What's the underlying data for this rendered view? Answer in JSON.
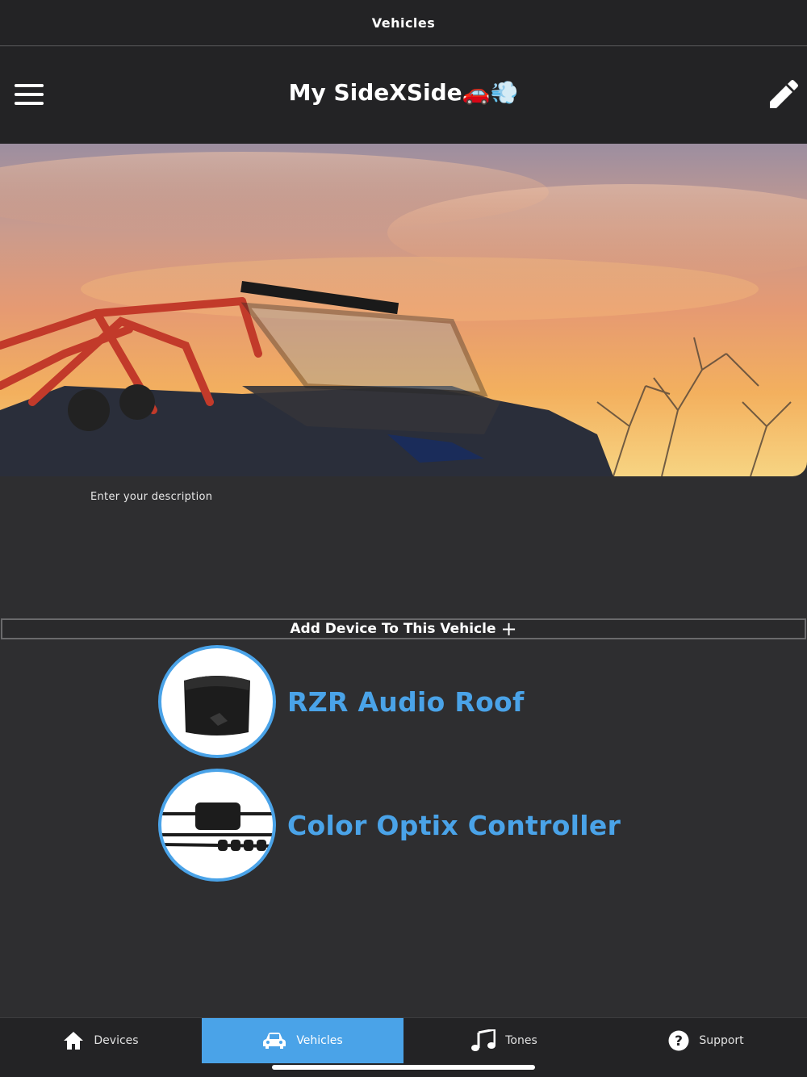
{
  "status_bar": {
    "title": "Vehicles"
  },
  "nav": {
    "title": "My SideXSide🚗💨"
  },
  "vehicle": {
    "description_placeholder": "Enter your description"
  },
  "add_device": {
    "label": "Add Device To This Vehicle",
    "icon": "+"
  },
  "devices": [
    {
      "name": "RZR Audio Roof",
      "icon": "audio-roof-product-image"
    },
    {
      "name": "Color Optix Controller",
      "icon": "color-optix-controller-product-image"
    }
  ],
  "tabs": [
    {
      "label": "Devices",
      "icon": "home-icon",
      "active": false
    },
    {
      "label": "Vehicles",
      "icon": "car-icon",
      "active": true
    },
    {
      "label": "Tones",
      "icon": "music-note-icon",
      "active": false
    },
    {
      "label": "Support",
      "icon": "help-icon",
      "active": false
    }
  ],
  "colors": {
    "accent": "#4aa3e8",
    "background": "#2e2e30",
    "bar": "#232325"
  }
}
